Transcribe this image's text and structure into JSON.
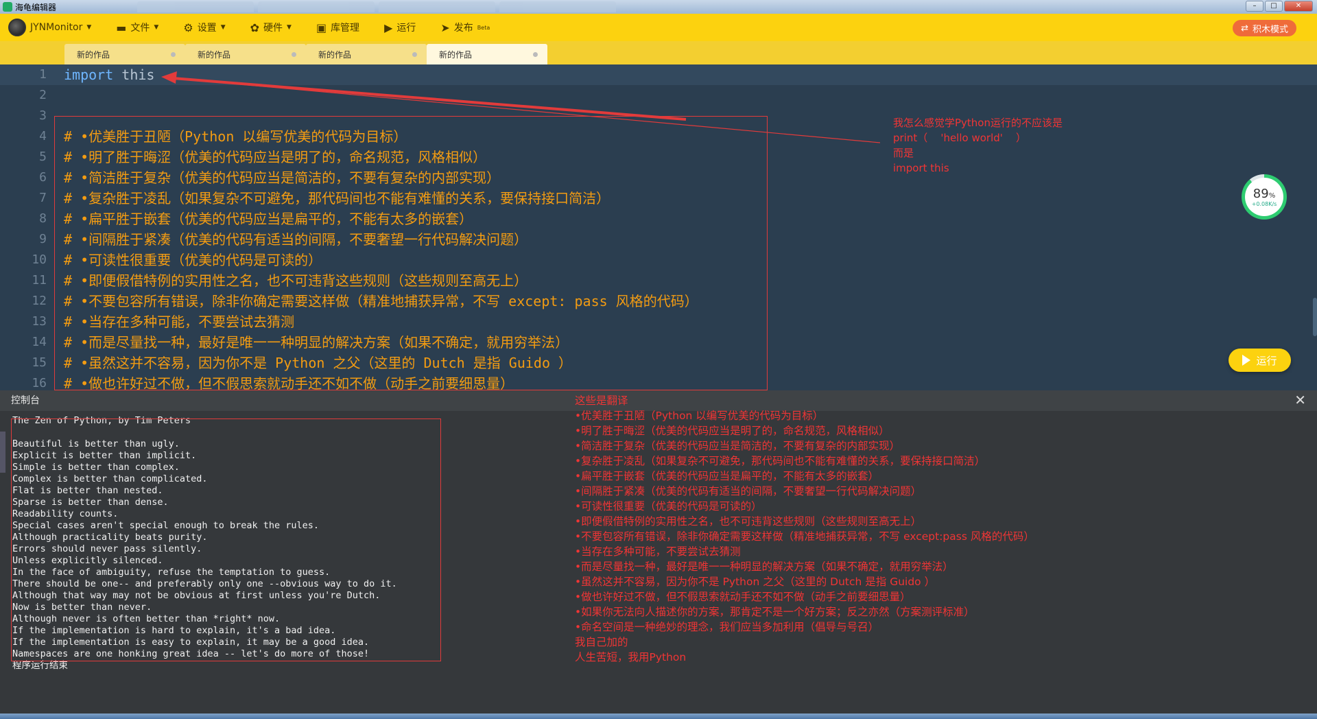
{
  "window": {
    "title": "海龟编辑器"
  },
  "toolbar": {
    "user": "JYNMonitor",
    "file": "文件",
    "settings": "设置",
    "hardware": "硬件",
    "library": "库管理",
    "run": "运行",
    "publish": "发布",
    "publish_beta": "Beta",
    "mode": "积木模式"
  },
  "tabs": [
    "新的作品",
    "新的作品",
    "新的作品",
    "新的作品"
  ],
  "editor": {
    "line_numbers": [
      "1",
      "2",
      "3",
      "4",
      "5",
      "6",
      "7",
      "8",
      "9",
      "10",
      "11",
      "12",
      "13",
      "14",
      "15",
      "16"
    ],
    "line1_kw": "import",
    "line1_id": "this",
    "comments": [
      "# •优美胜于丑陋（Python 以编写优美的代码为目标）",
      "# •明了胜于晦涩（优美的代码应当是明了的，命名规范，风格相似）",
      "# •简洁胜于复杂（优美的代码应当是简洁的，不要有复杂的内部实现）",
      "# •复杂胜于凌乱（如果复杂不可避免，那代码间也不能有难懂的关系，要保持接口简洁）",
      "# •扁平胜于嵌套（优美的代码应当是扁平的，不能有太多的嵌套）",
      "# •间隔胜于紧凑（优美的代码有适当的间隔，不要奢望一行代码解决问题）",
      "# •可读性很重要（优美的代码是可读的）",
      "# •即便假借特例的实用性之名，也不可违背这些规则（这些规则至高无上）",
      "# •不要包容所有错误，除非你确定需要这样做（精准地捕获异常，不写 except: pass 风格的代码）",
      "# •当存在多种可能，不要尝试去猜测",
      "# •而是尽量找一种，最好是唯一一种明显的解决方案（如果不确定，就用穷举法）",
      "# •虽然这并不容易，因为你不是 Python 之父（这里的 Dutch 是指 Guido ）",
      "# •做也许好过不做，但不假思索就动手还不如不做（动手之前要细思量）"
    ],
    "annotation": "我怎么感觉学Python运行的不应该是\nprint（    'hello world'    ）\n而是\nimport this",
    "progress_pct": "89",
    "progress_unit": "%",
    "progress_speed": "+0.08K/s",
    "run_label": "运行"
  },
  "console": {
    "title": "控制台",
    "close": "✕",
    "output": "The Zen of Python, by Tim Peters\n\nBeautiful is better than ugly.\nExplicit is better than implicit.\nSimple is better than complex.\nComplex is better than complicated.\nFlat is better than nested.\nSparse is better than dense.\nReadability counts.\nSpecial cases aren't special enough to break the rules.\nAlthough practicality beats purity.\nErrors should never pass silently.\nUnless explicitly silenced.\nIn the face of ambiguity, refuse the temptation to guess.\nThere should be one-- and preferably only one --obvious way to do it.\nAlthough that way may not be obvious at first unless you're Dutch.\nNow is better than never.\nAlthough never is often better than *right* now.\nIf the implementation is hard to explain, it's a bad idea.\nIf the implementation is easy to explain, it may be a good idea.\nNamespaces are one honking great idea -- let's do more of those!\n程序运行结束",
    "translation": "这些是翻译\n•优美胜于丑陋（Python 以编写优美的代码为目标）\n•明了胜于晦涩（优美的代码应当是明了的，命名规范，风格相似）\n•简洁胜于复杂（优美的代码应当是简洁的，不要有复杂的内部实现）\n•复杂胜于凌乱（如果复杂不可避免，那代码间也不能有难懂的关系，要保持接口简洁）\n•扁平胜于嵌套（优美的代码应当是扁平的，不能有太多的嵌套）\n•间隔胜于紧凑（优美的代码有适当的间隔，不要奢望一行代码解决问题）\n•可读性很重要（优美的代码是可读的）\n•即便假借特例的实用性之名，也不可违背这些规则（这些规则至高无上）\n•不要包容所有错误，除非你确定需要这样做（精准地捕获异常，不写 except:pass 风格的代码）\n•当存在多种可能，不要尝试去猜测\n•而是尽量找一种，最好是唯一一种明显的解决方案（如果不确定，就用穷举法）\n•虽然这并不容易，因为你不是 Python 之父（这里的 Dutch 是指 Guido ）\n•做也许好过不做，但不假思索就动手还不如不做（动手之前要细思量）\n•如果你无法向人描述你的方案，那肯定不是一个好方案；反之亦然（方案测评标准）\n•命名空间是一种绝妙的理念，我们应当多加利用（倡导与号召）\n我自己加的\n人生苦短，我用Python"
  },
  "colors": {
    "toolbar": "#fcd20f",
    "editor_bg": "#2b3e50",
    "comment": "#f39c12",
    "annotation": "#f03535",
    "console_bg": "#35383b"
  }
}
